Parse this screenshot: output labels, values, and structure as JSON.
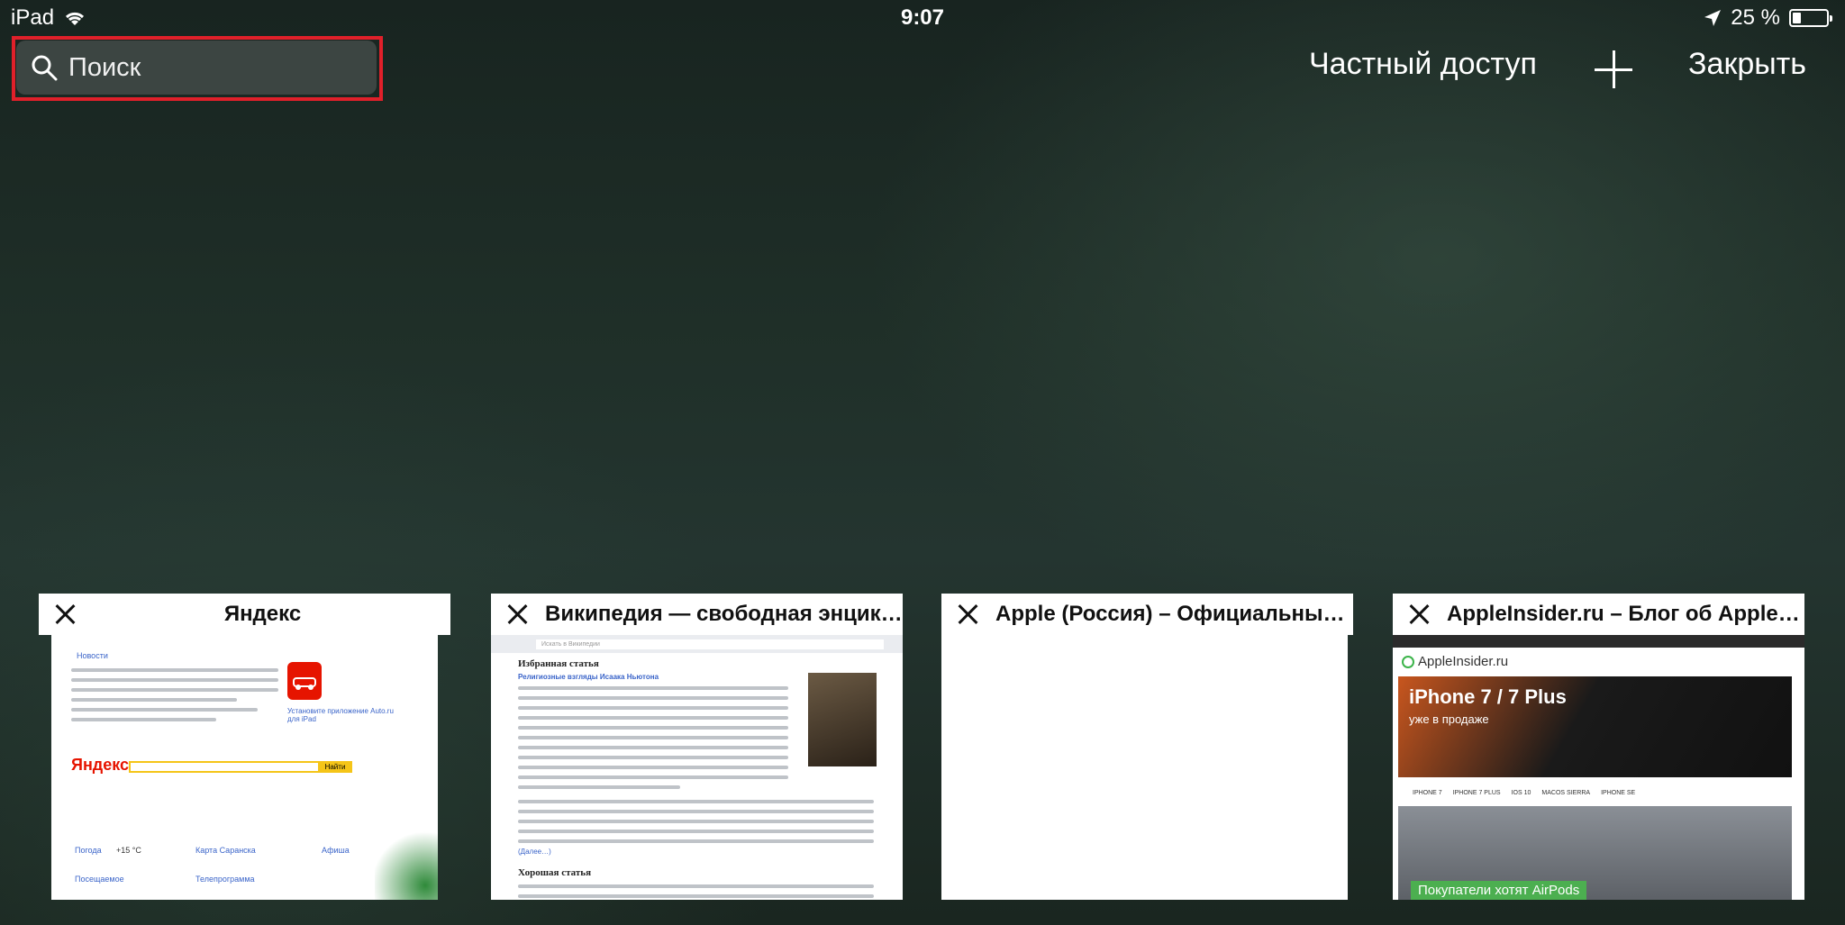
{
  "status_bar": {
    "device": "iPad",
    "time": "9:07",
    "battery_text": "25 %",
    "battery_level": 0.25
  },
  "search": {
    "placeholder": "Поиск"
  },
  "toolbar": {
    "private_label": "Частный доступ",
    "close_label": "Закрыть"
  },
  "tabs": [
    {
      "title": "Яндекс",
      "thumb": {
        "news_header": "Новости",
        "logo": "Яндекс",
        "button": "Найти",
        "weather": "Погода",
        "temp": "+15 °C",
        "map": "Карта Саранска",
        "poster": "Афиша",
        "tv": "Телепрограмма",
        "visited": "Посещаемое",
        "auto_ru": "Установите приложение Auto.ru для iPad"
      }
    },
    {
      "title": "Википедия — свободная энцик…",
      "thumb": {
        "search_placeholder": "Искать в Википедии",
        "featured": "Избранная статья",
        "good": "Хорошая статья",
        "more": "(Далее…)",
        "lead": "Религиозные взгляды Исаака Ньютона"
      }
    },
    {
      "title": "Apple (Россия) – Официальный…"
    },
    {
      "title": "AppleInsider.ru – Блог об Apple, i…",
      "thumb": {
        "logo": "AppleInsider.ru",
        "hero": "iPhone 7 / 7 Plus",
        "hero_sub": "уже в продаже",
        "nav": [
          "IPHONE 7",
          "IPHONE 7 PLUS",
          "IOS 10",
          "MACOS SIERRA",
          "IPHONE SE"
        ],
        "caption": "Покупатели хотят AirPods"
      }
    }
  ],
  "colors": {
    "highlight": "#e0202a",
    "yandex_red": "#e61400",
    "wiki_link": "#3a64c9"
  }
}
